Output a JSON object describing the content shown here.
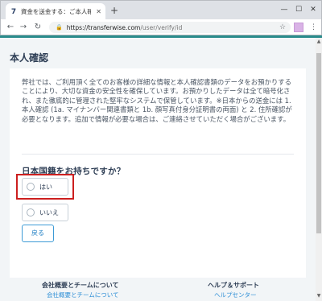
{
  "browser": {
    "tab_title": "資金を送金する：ご本人確認",
    "tab_favicon": "7",
    "url_host": "https://transferwise.com",
    "url_path": "/user/verify/id",
    "lock_icon": "🔒",
    "star_icon": "☆",
    "menu_icon": "⋮",
    "new_tab": "+",
    "close_tab": "✕",
    "back_icon": "←",
    "forward_icon": "→",
    "reload_icon": "↻",
    "win_min": "—",
    "win_max": "☐",
    "win_close": "✕"
  },
  "page": {
    "heading": "本人確認",
    "body_text": "弊社では、ご利用頂く全てのお客様の詳細な情報と本人確認書類のデータをお預かりすることにより、大切な資金の安全性を確保しています。お預かりしたデータは全て暗号化され、また徹底的に管理された堅牢なシステムで保管しています。※日本からの送金には 1. 本人確認 (1a. マイナンバー関連書類と 1b. 顔写真付身分証明書の両面) と 2. 住所確認が必要となります。追加で情報が必要な場合は、ご連絡させていただく場合がございます。",
    "question": "日本国籍をお持ちですか？",
    "options": [
      {
        "label": "はい",
        "selected": false
      },
      {
        "label": "いいえ",
        "selected": false
      }
    ],
    "back_button": "戻る"
  },
  "footer": {
    "col1_heading": "会社概要とチームについて",
    "col1_link": "会社概要とチームについて",
    "col2_heading": "ヘルプ＆サポート",
    "col2_link": "ヘルプセンター"
  },
  "colors": {
    "accent_teal": "#2a8c8c",
    "highlight_red": "#cc1f1f",
    "link_blue": "#2f8fd6",
    "heading_navy": "#2e3e55"
  }
}
